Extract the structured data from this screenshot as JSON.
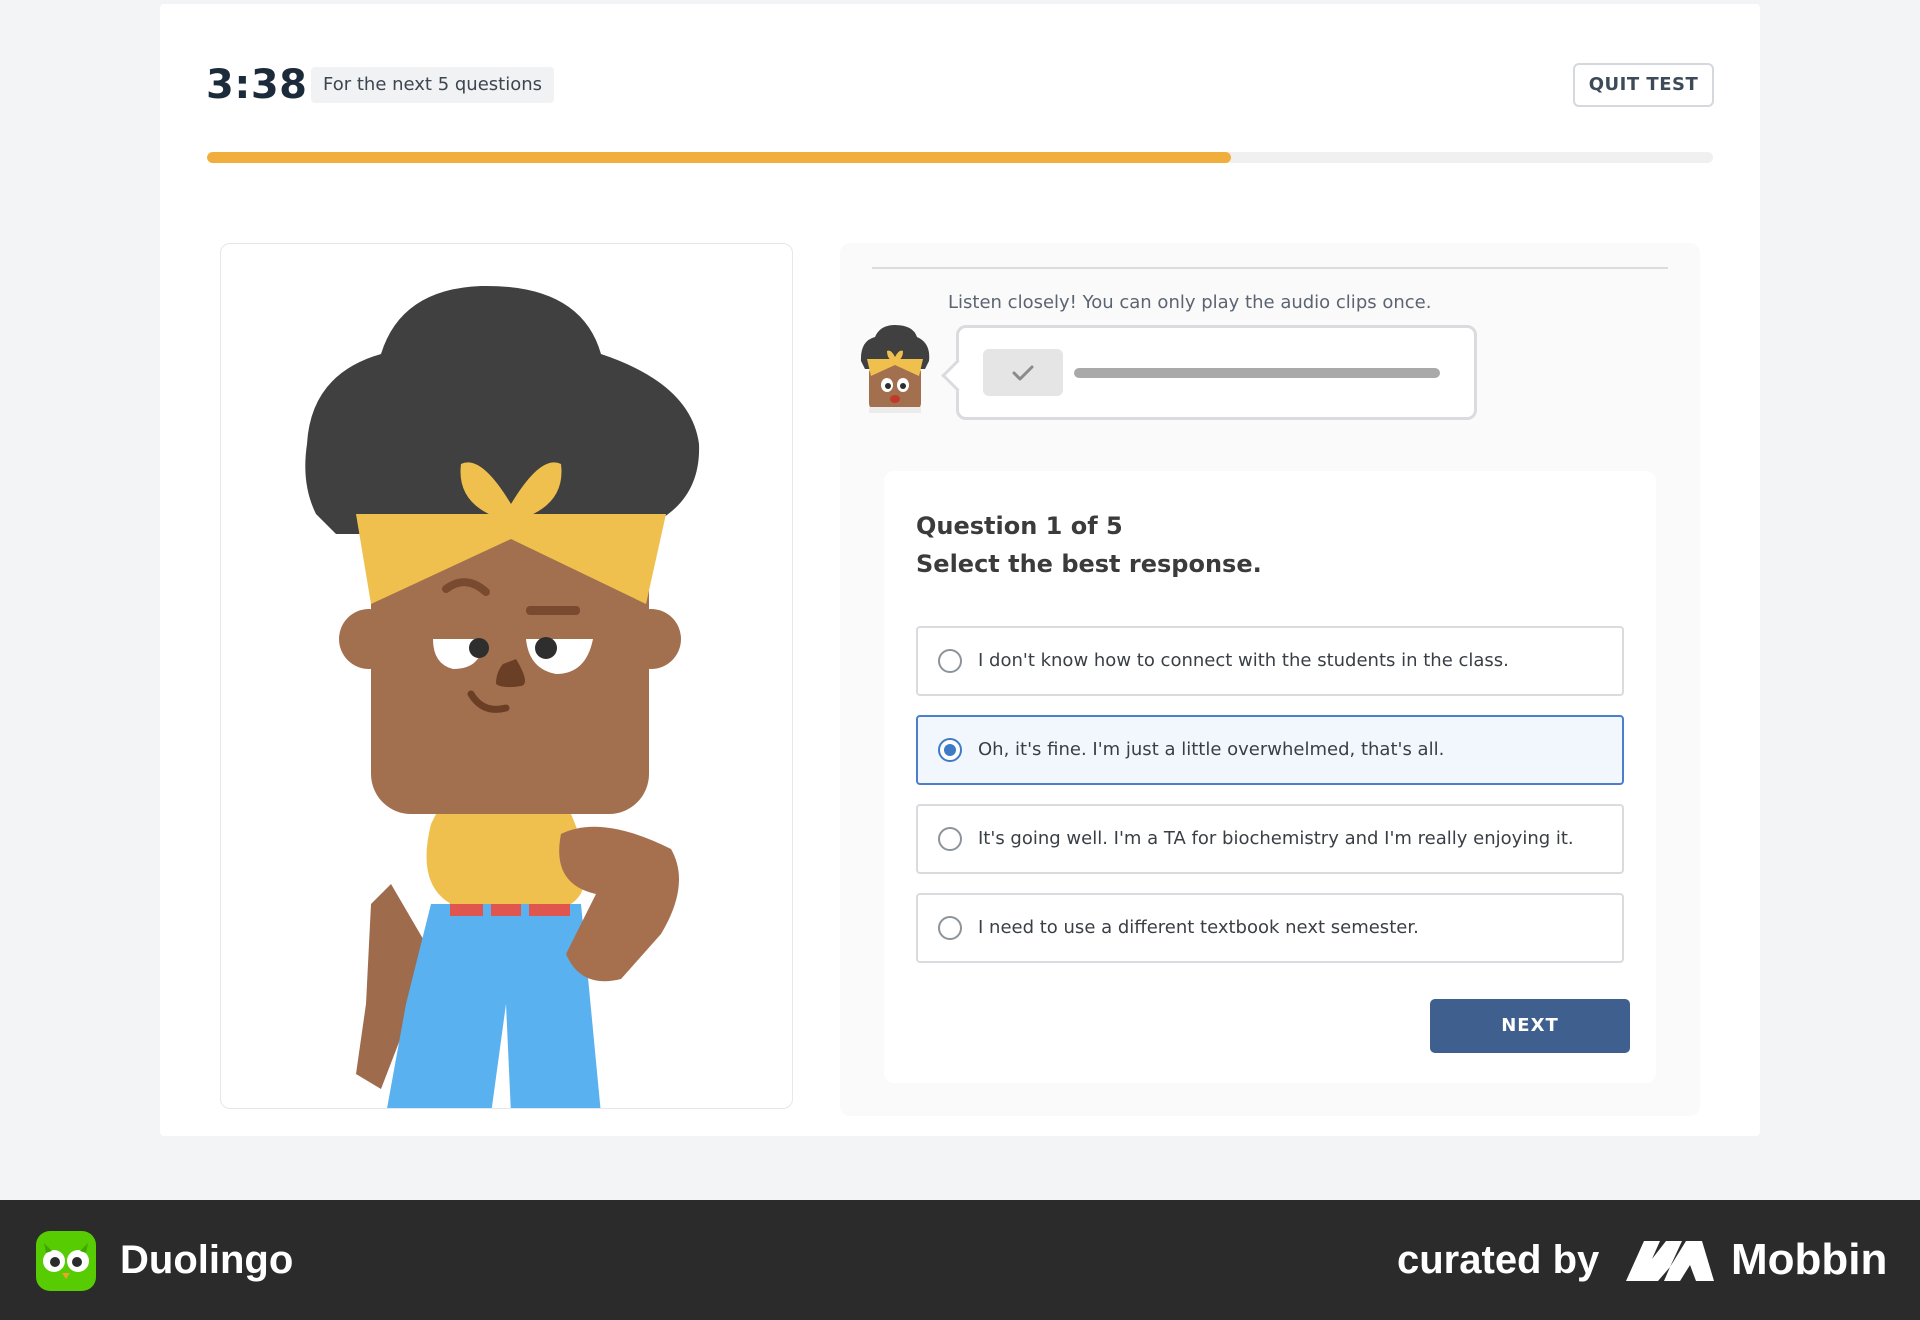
{
  "header": {
    "timer": "3:38",
    "timer_note": "For the next 5 questions",
    "quit_label": "QUIT TEST"
  },
  "progress": {
    "fraction": 0.68,
    "color": "#f2ae3d"
  },
  "audio": {
    "instruction": "Listen closely! You can only play the audio clips once.",
    "play_icon": "check-icon"
  },
  "question": {
    "number_text": "Question 1 of 5",
    "instruction": "Select the best response.",
    "options": [
      {
        "text": "I don't know how to connect with the students in the class.",
        "selected": false
      },
      {
        "text": "Oh, it's fine. I'm just a little overwhelmed, that's all.",
        "selected": true
      },
      {
        "text": "It's going well. I'm a TA for biochemistry and I'm really enjoying it.",
        "selected": false
      },
      {
        "text": "I need to use a different textbook next semester.",
        "selected": false
      }
    ],
    "next_label": "NEXT"
  },
  "footer": {
    "app_name": "Duolingo",
    "curated_by": "curated by",
    "brand": "Mobbin"
  },
  "colors": {
    "accent": "#3f5f8e",
    "selected_border": "#4a7fc9",
    "duolingo_green": "#58cc02"
  }
}
